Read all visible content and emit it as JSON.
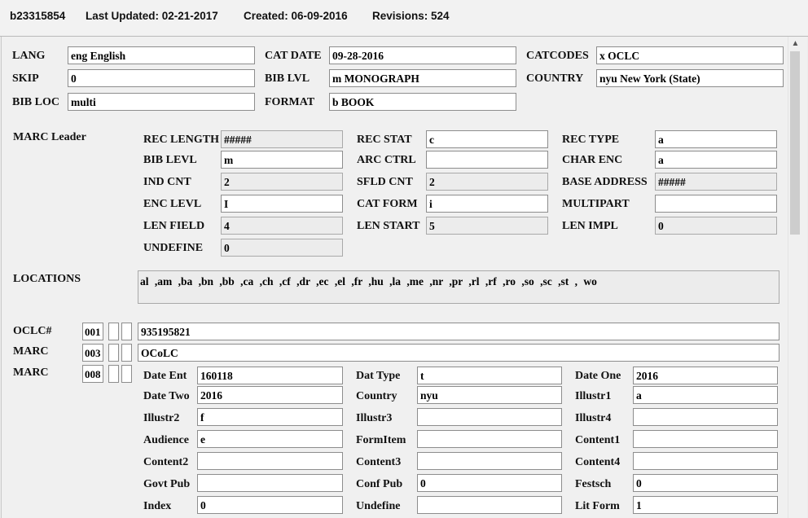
{
  "header": {
    "record_id": "b23315854",
    "last_updated": "Last Updated: 02-21-2017",
    "created": "Created: 06-09-2016",
    "revisions": "Revisions: 524"
  },
  "fixed_fields": [
    {
      "label": "LANG",
      "value": "eng  English"
    },
    {
      "label": "CAT DATE",
      "value": "09-28-2016"
    },
    {
      "label": "CATCODES",
      "value": "x  OCLC"
    },
    {
      "label": "SKIP",
      "value": "0"
    },
    {
      "label": "BIB LVL",
      "value": "m  MONOGRAPH"
    },
    {
      "label": "COUNTRY",
      "value": "nyu  New York (State)"
    },
    {
      "label": "BIB LOC",
      "value": "multi"
    },
    {
      "label": "FORMAT",
      "value": "b  BOOK"
    }
  ],
  "leader": {
    "title": "MARC Leader",
    "fields": [
      {
        "label": "REC LENGTH",
        "value": "#####",
        "readonly": true
      },
      {
        "label": "REC STAT",
        "value": "c",
        "readonly": false
      },
      {
        "label": "REC TYPE",
        "value": "a",
        "readonly": false
      },
      {
        "label": "BIB LEVL",
        "value": "m",
        "readonly": false
      },
      {
        "label": "ARC CTRL",
        "value": "",
        "readonly": false
      },
      {
        "label": "CHAR ENC",
        "value": "a",
        "readonly": false
      },
      {
        "label": "IND CNT",
        "value": "2",
        "readonly": true
      },
      {
        "label": "SFLD CNT",
        "value": "2",
        "readonly": true
      },
      {
        "label": "BASE ADDRESS",
        "value": "#####",
        "readonly": true
      },
      {
        "label": "ENC LEVL",
        "value": "I",
        "readonly": false
      },
      {
        "label": "CAT FORM",
        "value": "i",
        "readonly": false
      },
      {
        "label": "MULTIPART",
        "value": "",
        "readonly": false
      },
      {
        "label": "LEN FIELD",
        "value": "4",
        "readonly": true
      },
      {
        "label": "LEN START",
        "value": "5",
        "readonly": true
      },
      {
        "label": "LEN IMPL",
        "value": "0",
        "readonly": true
      },
      {
        "label": "UNDEFINE",
        "value": "0",
        "readonly": true
      }
    ]
  },
  "locations": {
    "label": "LOCATIONS",
    "text": "al ,am ,ba ,bn ,bb ,ca ,ch ,cf ,dr ,ec ,el ,fr ,hu ,la ,me ,nr ,pr ,rl ,rf ,ro ,so ,sc ,st , wo"
  },
  "marc_fields": [
    {
      "label": "OCLC#",
      "tag": "001",
      "value": "935195821"
    },
    {
      "label": "MARC",
      "tag": "003",
      "value": "OCoLC"
    },
    {
      "label": "MARC",
      "tag": "008",
      "value": ""
    }
  ],
  "field_008": [
    {
      "label": "Date Ent",
      "value": "160118"
    },
    {
      "label": "Dat Type",
      "value": "t"
    },
    {
      "label": "Date One",
      "value": "2016"
    },
    {
      "label": "Date Two",
      "value": "2016"
    },
    {
      "label": "Country",
      "value": "nyu"
    },
    {
      "label": "Illustr1",
      "value": "a"
    },
    {
      "label": "Illustr2",
      "value": "f"
    },
    {
      "label": "Illustr3",
      "value": ""
    },
    {
      "label": "Illustr4",
      "value": ""
    },
    {
      "label": "Audience",
      "value": "e"
    },
    {
      "label": "FormItem",
      "value": ""
    },
    {
      "label": "Content1",
      "value": ""
    },
    {
      "label": "Content2",
      "value": ""
    },
    {
      "label": "Content3",
      "value": ""
    },
    {
      "label": "Content4",
      "value": ""
    },
    {
      "label": "Govt Pub",
      "value": ""
    },
    {
      "label": "Conf Pub",
      "value": "0"
    },
    {
      "label": "Festsch",
      "value": "0"
    },
    {
      "label": "Index",
      "value": "0"
    },
    {
      "label": "Undefine",
      "value": ""
    },
    {
      "label": "Lit Form",
      "value": "1"
    }
  ],
  "scrollbar": {
    "up_icon": "chevron-up-icon"
  }
}
